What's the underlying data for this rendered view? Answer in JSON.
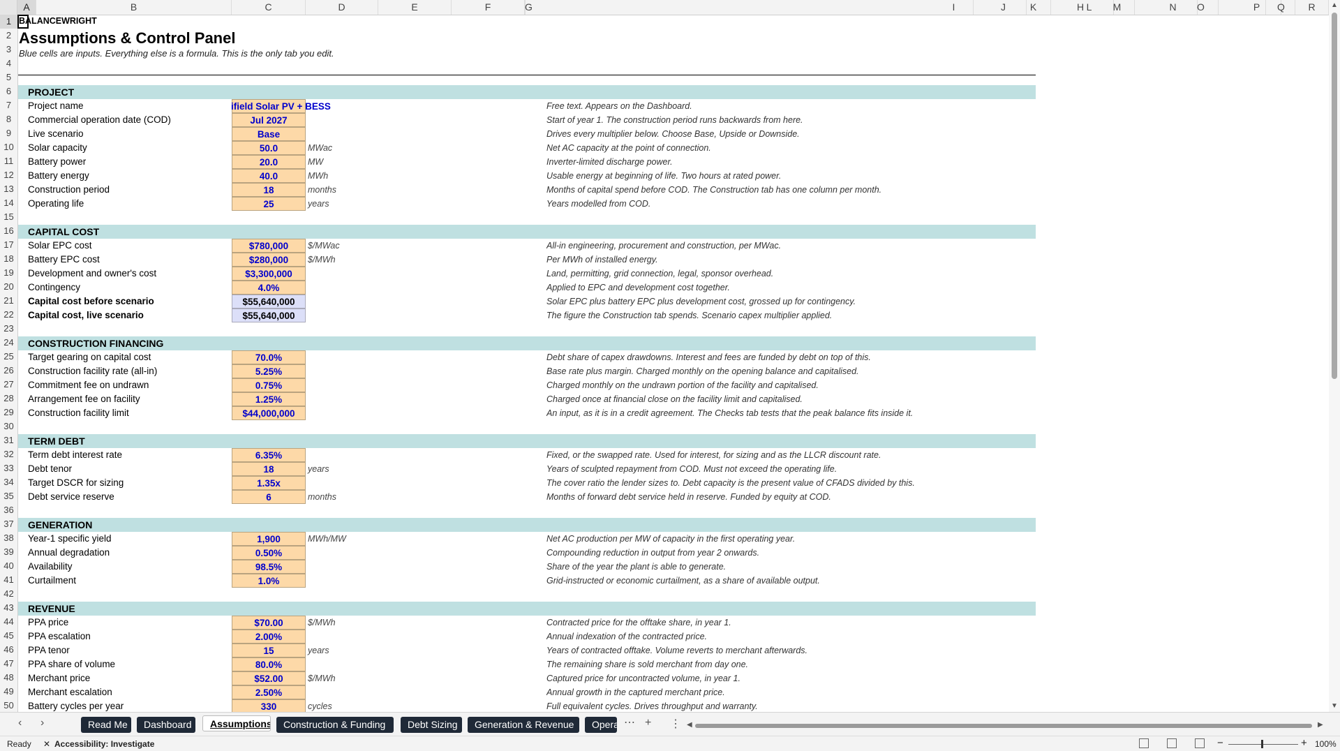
{
  "columns": [
    {
      "name": "A",
      "w": 27
    },
    {
      "name": "B",
      "w": 305
    },
    {
      "name": "C",
      "w": 106
    },
    {
      "name": "D",
      "w": 104
    },
    {
      "name": "E",
      "w": 105
    },
    {
      "name": "F",
      "w": 105
    },
    {
      "name": "G",
      "w": 0
    },
    {
      "name": "H",
      "w": 0
    },
    {
      "name": "I",
      "w": 56
    },
    {
      "name": "J",
      "w": 66
    },
    {
      "name": "K",
      "w": 51
    },
    {
      "name": "L",
      "w": 70
    },
    {
      "name": "M",
      "w": 50
    },
    {
      "name": "N",
      "w": 70
    },
    {
      "name": "O",
      "w": 50
    },
    {
      "name": "P",
      "w": 70
    },
    {
      "name": "Q",
      "w": 50
    },
    {
      "name": "R",
      "w": 40
    }
  ],
  "rows": [
    "1",
    "2",
    "3",
    "4",
    "5",
    "6",
    "7",
    "8",
    "9",
    "10",
    "11",
    "12",
    "13",
    "14",
    "15",
    "16",
    "17",
    "18",
    "19",
    "20",
    "21",
    "22",
    "23",
    "24",
    "25",
    "26",
    "27",
    "28",
    "29",
    "30",
    "31",
    "32",
    "33",
    "34",
    "35",
    "36",
    "37",
    "38",
    "39",
    "40",
    "41",
    "42",
    "43",
    "44",
    "45",
    "46",
    "47",
    "48",
    "49",
    "50"
  ],
  "header": {
    "brand": "BALANCEWRIGHT",
    "title": "Assumptions & Control Panel",
    "subtitle": "Blue cells are inputs. Everything else is a formula. This is the only tab you edit."
  },
  "sections": [
    {
      "row": 6,
      "label": "PROJECT"
    },
    {
      "row": 16,
      "label": "CAPITAL COST"
    },
    {
      "row": 24,
      "label": "CONSTRUCTION FINANCING"
    },
    {
      "row": 31,
      "label": "TERM DEBT"
    },
    {
      "row": 37,
      "label": "GENERATION"
    },
    {
      "row": 43,
      "label": "REVENUE"
    }
  ],
  "items": [
    {
      "row": 7,
      "label": "Project name",
      "value": "ifield Solar PV + BESS",
      "unit": "",
      "note": "Free text. Appears on the Dashboard.",
      "kind": "input"
    },
    {
      "row": 8,
      "label": "Commercial operation date (COD)",
      "value": "Jul 2027",
      "unit": "",
      "note": "Start of year 1. The construction period runs backwards from here.",
      "kind": "input"
    },
    {
      "row": 9,
      "label": "Live scenario",
      "value": "Base",
      "unit": "",
      "note": "Drives every multiplier below. Choose Base, Upside or Downside.",
      "kind": "input"
    },
    {
      "row": 10,
      "label": "Solar capacity",
      "value": "50.0",
      "unit": "MWac",
      "note": "Net AC capacity at the point of connection.",
      "kind": "input"
    },
    {
      "row": 11,
      "label": "Battery power",
      "value": "20.0",
      "unit": "MW",
      "note": "Inverter-limited discharge power.",
      "kind": "input"
    },
    {
      "row": 12,
      "label": "Battery energy",
      "value": "40.0",
      "unit": "MWh",
      "note": "Usable energy at beginning of life. Two hours at rated power.",
      "kind": "input"
    },
    {
      "row": 13,
      "label": "Construction period",
      "value": "18",
      "unit": "months",
      "note": "Months of capital spend before COD. The Construction tab has one column per month.",
      "kind": "input"
    },
    {
      "row": 14,
      "label": "Operating life",
      "value": "25",
      "unit": "years",
      "note": "Years modelled from COD.",
      "kind": "input"
    },
    {
      "row": 17,
      "label": "Solar EPC cost",
      "value": "$780,000",
      "unit": "$/MWac",
      "note": "All-in engineering, procurement and construction, per MWac.",
      "kind": "input"
    },
    {
      "row": 18,
      "label": "Battery EPC cost",
      "value": "$280,000",
      "unit": "$/MWh",
      "note": "Per MWh of installed energy.",
      "kind": "input"
    },
    {
      "row": 19,
      "label": "Development and owner's cost",
      "value": "$3,300,000",
      "unit": "",
      "note": "Land, permitting, grid connection, legal, sponsor overhead.",
      "kind": "input"
    },
    {
      "row": 20,
      "label": "Contingency",
      "value": "4.0%",
      "unit": "",
      "note": "Applied to EPC and development cost together.",
      "kind": "input"
    },
    {
      "row": 21,
      "label": "Capital cost before scenario",
      "value": "$55,640,000",
      "unit": "",
      "note": "Solar EPC plus battery EPC plus development cost, grossed up for contingency.",
      "kind": "calc"
    },
    {
      "row": 22,
      "label": "Capital cost, live scenario",
      "value": "$55,640,000",
      "unit": "",
      "note": "The figure the Construction tab spends. Scenario capex multiplier applied.",
      "kind": "calc"
    },
    {
      "row": 25,
      "label": "Target gearing on capital cost",
      "value": "70.0%",
      "unit": "",
      "note": "Debt share of capex drawdowns. Interest and fees are funded by debt on top of this.",
      "kind": "input"
    },
    {
      "row": 26,
      "label": "Construction facility rate (all-in)",
      "value": "5.25%",
      "unit": "",
      "note": "Base rate plus margin. Charged monthly on the opening balance and capitalised.",
      "kind": "input"
    },
    {
      "row": 27,
      "label": "Commitment fee on undrawn",
      "value": "0.75%",
      "unit": "",
      "note": "Charged monthly on the undrawn portion of the facility and capitalised.",
      "kind": "input"
    },
    {
      "row": 28,
      "label": "Arrangement fee on facility",
      "value": "1.25%",
      "unit": "",
      "note": "Charged once at financial close on the facility limit and capitalised.",
      "kind": "input"
    },
    {
      "row": 29,
      "label": "Construction facility limit",
      "value": "$44,000,000",
      "unit": "",
      "note": "An input, as it is in a credit agreement. The Checks tab tests that the peak balance fits inside it.",
      "kind": "input"
    },
    {
      "row": 32,
      "label": "Term debt interest rate",
      "value": "6.35%",
      "unit": "",
      "note": "Fixed, or the swapped rate. Used for interest, for sizing and as the LLCR discount rate.",
      "kind": "input"
    },
    {
      "row": 33,
      "label": "Debt tenor",
      "value": "18",
      "unit": "years",
      "note": "Years of sculpted repayment from COD. Must not exceed the operating life.",
      "kind": "input"
    },
    {
      "row": 34,
      "label": "Target DSCR for sizing",
      "value": "1.35x",
      "unit": "",
      "note": "The cover ratio the lender sizes to. Debt capacity is the present value of CFADS divided by this.",
      "kind": "input"
    },
    {
      "row": 35,
      "label": "Debt service reserve",
      "value": "6",
      "unit": "months",
      "note": "Months of forward debt service held in reserve. Funded by equity at COD.",
      "kind": "input"
    },
    {
      "row": 38,
      "label": "Year-1 specific yield",
      "value": "1,900",
      "unit": "MWh/MW",
      "note": "Net AC production per MW of capacity in the first operating year.",
      "kind": "input"
    },
    {
      "row": 39,
      "label": "Annual degradation",
      "value": "0.50%",
      "unit": "",
      "note": "Compounding reduction in output from year 2 onwards.",
      "kind": "input"
    },
    {
      "row": 40,
      "label": "Availability",
      "value": "98.5%",
      "unit": "",
      "note": "Share of the year the plant is able to generate.",
      "kind": "input"
    },
    {
      "row": 41,
      "label": "Curtailment",
      "value": "1.0%",
      "unit": "",
      "note": "Grid-instructed or economic curtailment, as a share of available output.",
      "kind": "input"
    },
    {
      "row": 44,
      "label": "PPA price",
      "value": "$70.00",
      "unit": "$/MWh",
      "note": "Contracted price for the offtake share, in year 1.",
      "kind": "input"
    },
    {
      "row": 45,
      "label": "PPA escalation",
      "value": "2.00%",
      "unit": "",
      "note": "Annual indexation of the contracted price.",
      "kind": "input"
    },
    {
      "row": 46,
      "label": "PPA tenor",
      "value": "15",
      "unit": "years",
      "note": "Years of contracted offtake. Volume reverts to merchant afterwards.",
      "kind": "input"
    },
    {
      "row": 47,
      "label": "PPA share of volume",
      "value": "80.0%",
      "unit": "",
      "note": "The remaining share is sold merchant from day one.",
      "kind": "input"
    },
    {
      "row": 48,
      "label": "Merchant price",
      "value": "$52.00",
      "unit": "$/MWh",
      "note": "Captured price for uncontracted volume, in year 1.",
      "kind": "input"
    },
    {
      "row": 49,
      "label": "Merchant escalation",
      "value": "2.50%",
      "unit": "",
      "note": "Annual growth in the captured merchant price.",
      "kind": "input"
    },
    {
      "row": 50,
      "label": "Battery cycles per year",
      "value": "330",
      "unit": "cycles",
      "note": "Full equivalent cycles. Drives throughput and warranty.",
      "kind": "input"
    }
  ],
  "tabs": [
    "Read Me",
    "Dashboard",
    "Assumptions",
    "Construction & Funding",
    "Debt Sizing",
    "Generation & Revenue",
    "Opera"
  ],
  "active_tab": "Assumptions",
  "tabbar_icons": {
    "prev": "chevron-left-icon",
    "next": "chevron-right-icon",
    "more": "more-icon",
    "add": "plus-icon",
    "options": "vertical-dots-icon"
  },
  "status": {
    "ready": "Ready",
    "accessibility": "Accessibility: Investigate",
    "zoom": "100%"
  },
  "colors": {
    "input_fill": "#fdd9a8",
    "input_text": "#0000cc",
    "calc_fill": "#dcdff8",
    "section_fill": "#bfe0e1",
    "tab_dark": "#1f2937"
  }
}
